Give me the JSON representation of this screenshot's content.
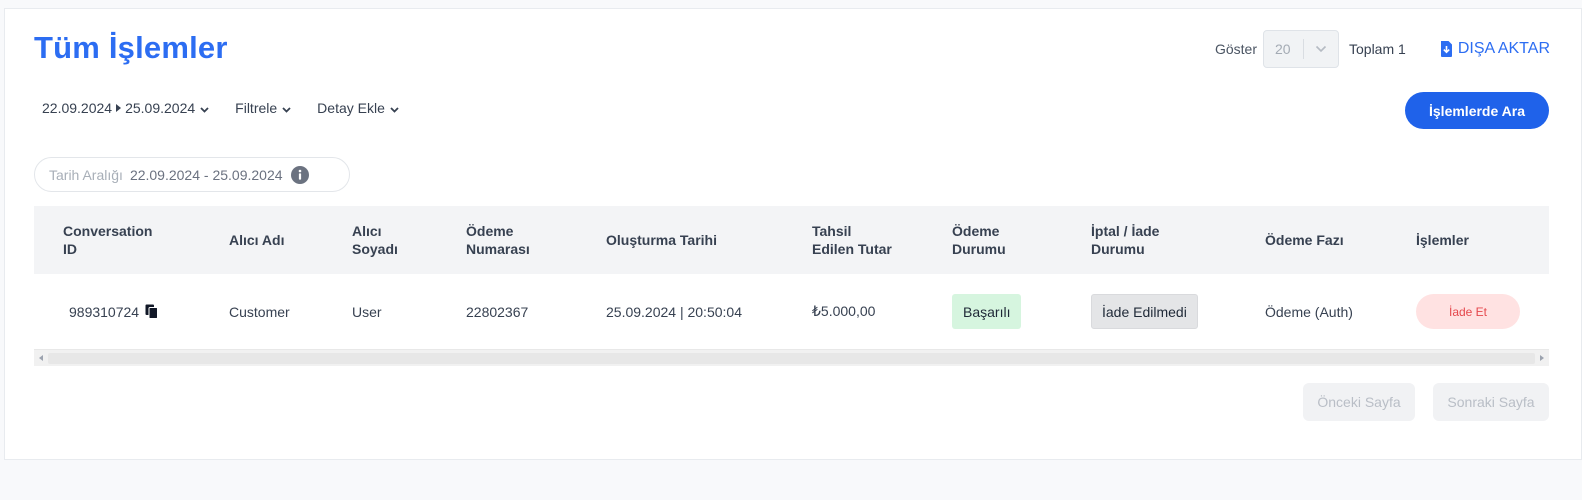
{
  "page": {
    "title": "Tüm İşlemler"
  },
  "toolbar": {
    "show_label": "Göster",
    "page_size": "20",
    "total_label": "Toplam 1",
    "export_label": "DIŞA AKTAR"
  },
  "filters": {
    "date_start": "22.09.2024",
    "date_end": "25.09.2024",
    "filter_label": "Filtrele",
    "add_detail_label": "Detay Ekle",
    "search_button": "İşlemlerde Ara"
  },
  "active_filter": {
    "label": "Tarih Aralığı",
    "value": "22.09.2024 - 25.09.2024"
  },
  "table": {
    "headers": [
      "Conversation ID",
      "Alıcı Adı",
      "Alıcı Soyadı",
      "Ödeme Numarası",
      "Oluşturma Tarihi",
      "Tahsil Edilen Tutar",
      "Ödeme Durumu",
      "İptal / İade Durumu",
      "Ödeme Fazı",
      "İşlemler"
    ],
    "header_lines": [
      [
        "Conversation",
        "ID"
      ],
      [
        "Alıcı Adı"
      ],
      [
        "Alıcı",
        "Soyadı"
      ],
      [
        "Ödeme",
        "Numarası"
      ],
      [
        "Oluşturma Tarihi"
      ],
      [
        "Tahsil",
        "Edilen Tutar"
      ],
      [
        "Ödeme",
        "Durumu"
      ],
      [
        "İptal / İade",
        "Durumu"
      ],
      [
        "Ödeme Fazı"
      ],
      [
        "İşlemler"
      ]
    ],
    "rows": [
      {
        "conversation_id": "989310724",
        "first_name": "Customer",
        "last_name": "User",
        "payment_number": "22802367",
        "created_at": "25.09.2024 | 20:50:04",
        "amount": "₺5.000,00",
        "payment_status": "Başarılı",
        "refund_status": "İade Edilmedi",
        "payment_phase": "Ödeme (Auth)",
        "action": "İade Et"
      }
    ]
  },
  "pagination": {
    "prev_label": "Önceki Sayfa",
    "next_label": "Sonraki Sayfa"
  },
  "colors": {
    "accent": "#2c6df2",
    "primary_button": "#1f62ea",
    "success_bg": "#d6f5df",
    "danger_bg": "#ffe2e2",
    "danger_text": "#e5484d"
  },
  "icons": {
    "export": "download-icon",
    "copy": "copy-icon",
    "info": "info-icon",
    "dropdown": "chevron-down-icon"
  }
}
